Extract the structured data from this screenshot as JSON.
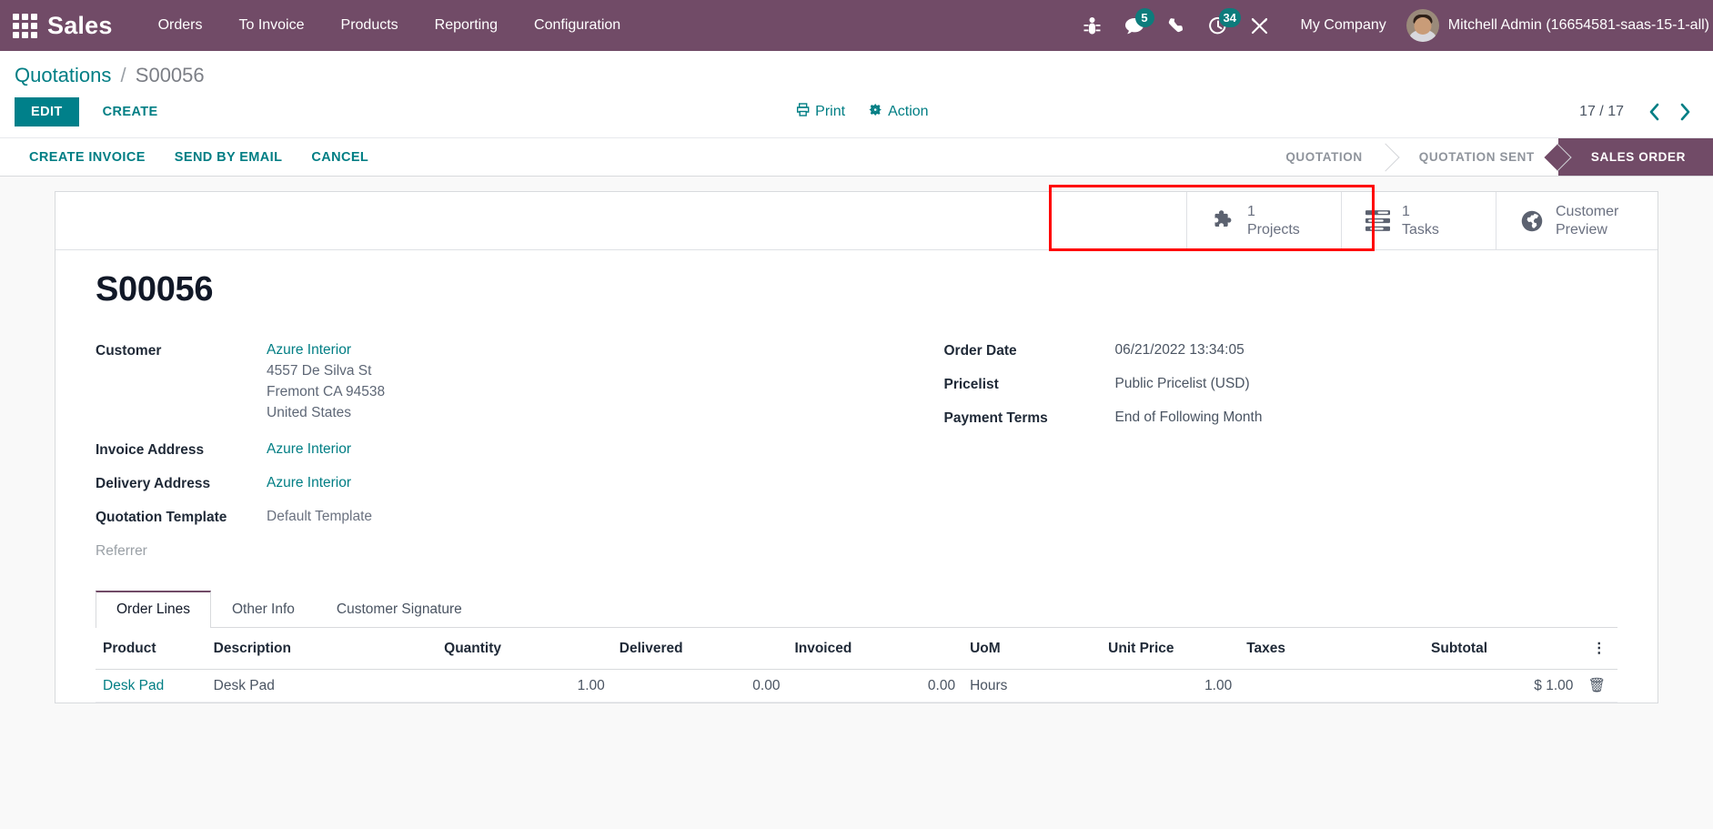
{
  "navbar": {
    "apps_icon": "apps-grid-icon",
    "brand": "Sales",
    "menu": [
      {
        "label": "Orders"
      },
      {
        "label": "To Invoice"
      },
      {
        "label": "Products"
      },
      {
        "label": "Reporting"
      },
      {
        "label": "Configuration"
      }
    ],
    "systray": [
      {
        "icon": "bug-icon",
        "badge": null
      },
      {
        "icon": "messages-icon",
        "badge": "5"
      },
      {
        "icon": "phone-icon",
        "badge": null
      },
      {
        "icon": "activity-clock-icon",
        "badge": "34"
      },
      {
        "icon": "tools-icon",
        "badge": null
      }
    ],
    "company": "My Company",
    "user": "Mitchell Admin (16654581-saas-15-1-all)",
    "avatar": "user-avatar",
    "accent_color": "#714B67",
    "badge_color": "#0d7c7c"
  },
  "control_panel": {
    "breadcrumb": {
      "root": "Quotations",
      "separator": "/",
      "current": "S00056"
    },
    "edit_label": "EDIT",
    "create_label": "CREATE",
    "print_label": "Print",
    "action_label": "Action",
    "print_icon": "printer-icon",
    "action_icon": "gear-icon",
    "pager": {
      "count": "17 / 17",
      "prev_icon": "chevron-left-icon",
      "next_icon": "chevron-right-icon"
    }
  },
  "statusbar": {
    "buttons": [
      {
        "label": "CREATE INVOICE"
      },
      {
        "label": "SEND BY EMAIL"
      },
      {
        "label": "CANCEL"
      }
    ],
    "stages": [
      {
        "label": "QUOTATION",
        "active": false
      },
      {
        "label": "QUOTATION SENT",
        "active": false
      },
      {
        "label": "SALES ORDER",
        "active": true
      }
    ],
    "active_color": "#714B67"
  },
  "smart_buttons": [
    {
      "value": "1",
      "label": "Projects",
      "icon": "puzzle-piece-icon",
      "highlighted": true
    },
    {
      "value": "1",
      "label": "Tasks",
      "icon": "tasks-list-icon",
      "highlighted": true
    },
    {
      "value": "",
      "label": "Customer\nPreview",
      "label_line1": "Customer",
      "label_line2": "Preview",
      "icon": "globe-icon",
      "highlighted": false
    }
  ],
  "highlight": {
    "color": "#ff0000"
  },
  "form": {
    "title": "S00056",
    "left": [
      {
        "label": "Customer",
        "value": "Azure Interior",
        "is_link": true,
        "sublines": [
          "4557 De Silva St",
          "Fremont CA 94538",
          "United States"
        ]
      },
      {
        "label": "Invoice Address",
        "value": "Azure Interior",
        "is_link": true
      },
      {
        "label": "Delivery Address",
        "value": "Azure Interior",
        "is_link": true
      },
      {
        "label": "Quotation Template",
        "value": "Default Template",
        "is_link": false
      },
      {
        "label": "Referrer",
        "value": "",
        "is_link": false,
        "label_muted": true
      }
    ],
    "right": [
      {
        "label": "Order Date",
        "value": "06/21/2022 13:34:05"
      },
      {
        "label": "Pricelist",
        "value": "Public Pricelist (USD)"
      },
      {
        "label": "Payment Terms",
        "value": "End of Following Month"
      }
    ]
  },
  "notebook": {
    "tabs": [
      {
        "label": "Order Lines",
        "active": true
      },
      {
        "label": "Other Info",
        "active": false
      },
      {
        "label": "Customer Signature",
        "active": false
      }
    ]
  },
  "order_lines": {
    "columns": [
      "Product",
      "Description",
      "Quantity",
      "Delivered",
      "Invoiced",
      "UoM",
      "Unit Price",
      "Taxes",
      "Subtotal"
    ],
    "optional_icon": "vertical-dots-icon",
    "rows": [
      {
        "product": "Desk Pad",
        "description": "Desk Pad",
        "quantity": "1.00",
        "delivered": "0.00",
        "invoiced": "0.00",
        "uom": "Hours",
        "unit_price": "1.00",
        "taxes": "",
        "subtotal": "$ 1.00",
        "delete_icon": "trash-icon"
      }
    ]
  }
}
